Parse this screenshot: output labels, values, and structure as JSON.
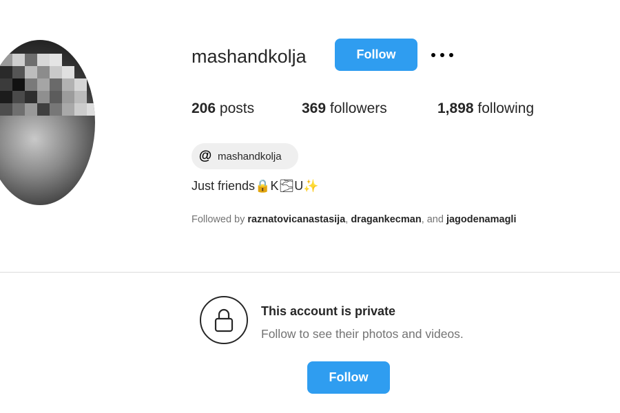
{
  "profile": {
    "username": "mashandkolja",
    "follow_label": "Follow",
    "more_icon": "more-horizontal-icon",
    "stats": {
      "posts_count": "206",
      "posts_label": "posts",
      "followers_count": "369",
      "followers_label": "followers",
      "following_count": "1,898",
      "following_label": "following"
    },
    "threads": {
      "icon": "threads-icon",
      "handle": "mashandkolja"
    },
    "bio": "Just friends🔒K🌫U✨",
    "followed_by": {
      "prefix": "Followed by",
      "accounts": [
        "raznatovicanastasija",
        "dragankecman",
        "jagodenamagli"
      ],
      "sep1": ", ",
      "sep2": ", and "
    }
  },
  "private_notice": {
    "icon": "lock-icon",
    "title": "This account is private",
    "subtitle": "Follow to see their photos and videos.",
    "follow_label": "Follow"
  },
  "colors": {
    "accent": "#2f9df0",
    "text": "#262626",
    "muted": "#737373",
    "divider": "#dbdbdb",
    "pill": "#efefef"
  }
}
